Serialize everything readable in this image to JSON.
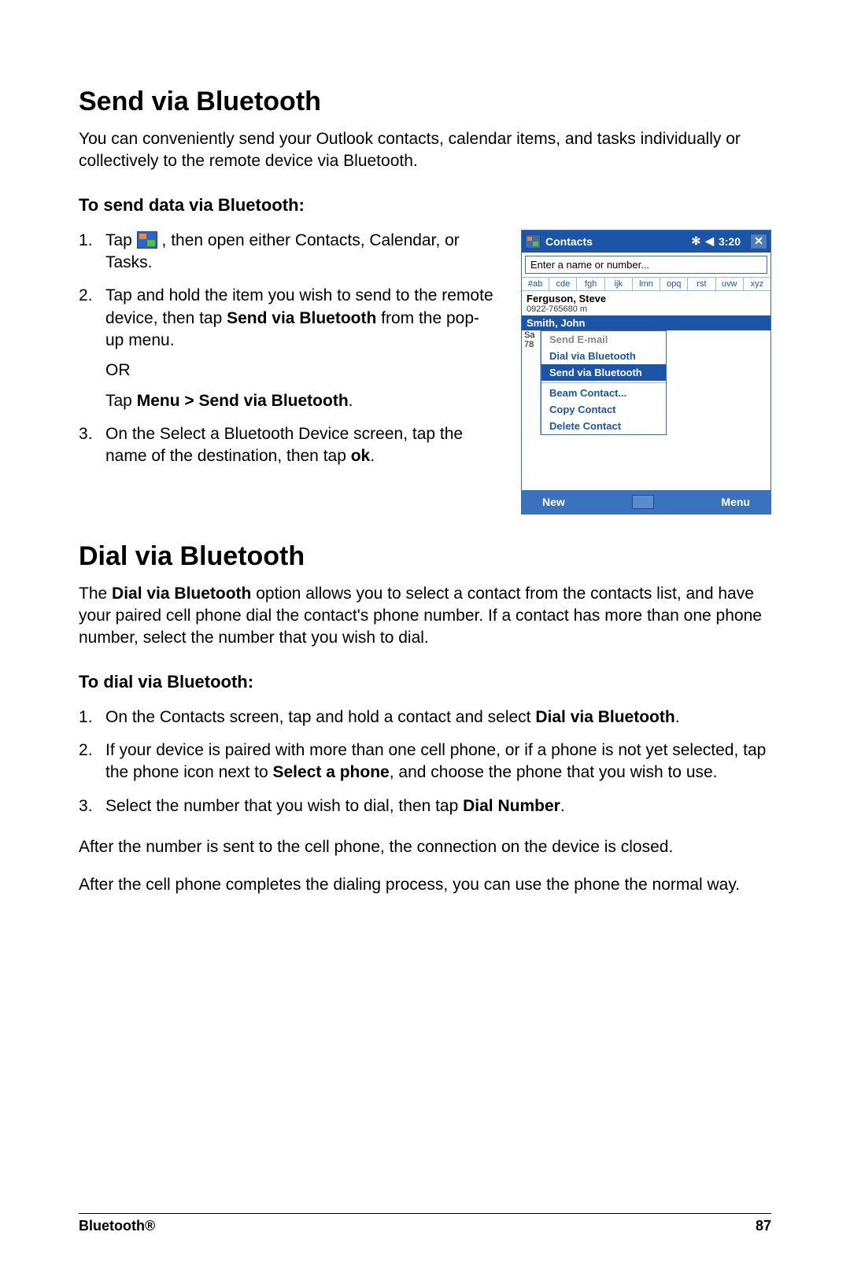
{
  "section1": {
    "heading": "Send via Bluetooth",
    "intro": "You can conveniently send your Outlook contacts, calendar items, and tasks individually or collectively to the remote device via Bluetooth.",
    "subheading": "To send data via Bluetooth:",
    "step1_a": "Tap ",
    "step1_b": " , then open either Contacts, Calendar, or Tasks.",
    "step2_a": "Tap and hold the item you wish to send to the remote device, then tap ",
    "step2_bold1": "Send via Bluetooth",
    "step2_b": " from the pop-up menu.",
    "step2_or": "OR",
    "step2_c": "Tap ",
    "step2_bold2": "Menu > Send via Bluetooth",
    "step2_d": ".",
    "step3_a": "On the Select a Bluetooth Device screen, tap the name of the destination, then tap ",
    "step3_bold": "ok",
    "step3_b": "."
  },
  "shot": {
    "title": "Contacts",
    "time": "3:20",
    "signal": "◀",
    "bt": "✻",
    "close": "✕",
    "search": "Enter a name or number...",
    "alpha": [
      "#ab",
      "cde",
      "fgh",
      "ijk",
      "lmn",
      "opq",
      "rst",
      "uvw",
      "xyz"
    ],
    "row1_name": "Ferguson, Steve",
    "row1_num": "0922-765680   m",
    "row2_name": "Smith, John",
    "clip1": "Sa",
    "clip2": "78",
    "menu_send_email": "Send E-mail",
    "menu_dial_bt": "Dial via Bluetooth",
    "menu_send_bt": "Send via Bluetooth",
    "menu_beam": "Beam Contact...",
    "menu_copy": "Copy Contact",
    "menu_delete": "Delete Contact",
    "btn_new": "New",
    "btn_menu": "Menu"
  },
  "section2": {
    "heading": "Dial via Bluetooth",
    "intro_a": "The ",
    "intro_bold": "Dial via Bluetooth",
    "intro_b": " option allows you to select a contact from the contacts list, and have your paired cell phone dial the contact's phone number. If a contact has more than one phone number, select the number that you wish to dial.",
    "subheading": "To dial via Bluetooth:",
    "step1_a": "On the Contacts screen, tap and hold a contact and select ",
    "step1_bold": "Dial via Bluetooth",
    "step1_b": ".",
    "step2_a": "If your device is paired with more than one cell phone, or if a phone is not yet selected, tap the phone icon next to ",
    "step2_bold": "Select a phone",
    "step2_b": ", and choose the phone that you wish to use.",
    "step3_a": "Select the number that you wish to dial, then tap ",
    "step3_bold": "Dial Number",
    "step3_b": ".",
    "after1": "After the number is sent to the cell phone, the connection on the device is closed.",
    "after2": "After the cell phone completes the dialing process, you can use the phone the normal way."
  },
  "footer": {
    "left": "Bluetooth®",
    "right": "87"
  }
}
